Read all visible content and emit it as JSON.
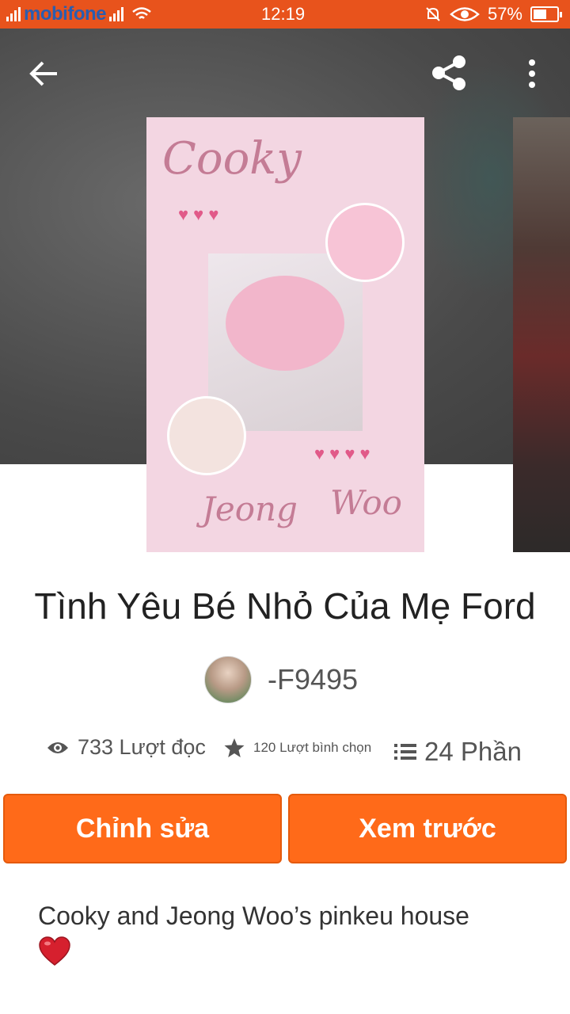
{
  "status_bar": {
    "carrier": "mobifone",
    "time": "12:19",
    "battery": "57%",
    "battery_level": 0.57
  },
  "toolbar": {
    "back_icon": "arrow-left-icon",
    "share_icon": "share-icon",
    "more_icon": "more-vertical-icon"
  },
  "cover": {
    "words": [
      "Cooky",
      "Jeong",
      "Woo"
    ]
  },
  "story": {
    "title": "Tình Yêu Bé Nhỏ Của Mẹ Ford",
    "author": "-F9495",
    "reads": "733 Lượt đọc",
    "votes": "120 Lượt bình chọn",
    "parts": "24 Phần",
    "description": "Cooky and Jeong Woo’s pinkeu house"
  },
  "buttons": {
    "edit": "Chỉnh sửa",
    "preview": "Xem trước"
  },
  "colors": {
    "status_bar": "#e8531c",
    "accent": "#ff6a19"
  }
}
